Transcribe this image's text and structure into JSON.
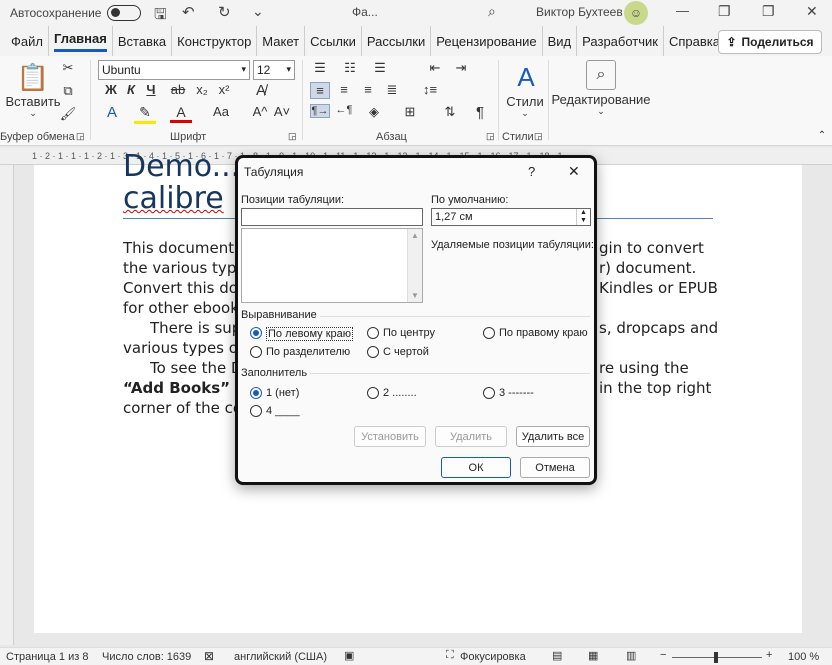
{
  "titlebar": {
    "autosave_label": "Автосохранение",
    "doc_name": "Фа...",
    "title_dots": "•",
    "user_name": "Виктор Бухтеев"
  },
  "menu": {
    "tabs": [
      "Файл",
      "Главная",
      "Вставка",
      "Конструктор",
      "Макет",
      "Ссылки",
      "Рассылки",
      "Рецензирование",
      "Вид",
      "Разработчик",
      "Справка"
    ],
    "share_label": "Поделиться"
  },
  "ribbon": {
    "paste_label": "Вставить",
    "clipboard_label": "Буфер обмена",
    "font_name": "Ubuntu",
    "font_size": "12",
    "font_group_label": "Шрифт",
    "para_group_label": "Абзац",
    "styles_label": "Стили",
    "styles_group_label": "Стили",
    "editing_label": "Редактирование",
    "bold": "Ж",
    "italic": "К",
    "underline": "Ч",
    "strike": "ab",
    "sub": "x₂",
    "sup": "x²",
    "case": "Aa",
    "grow": "A^",
    "shrink": "A˅"
  },
  "ruler_text": "1 · 2 · 1 · 1 · 1 · 2 · 1 · 3 · 1 · 4 · 1 · 5 · 1 · 6 · 1 · 7 · 1 · 8 · 1 · 9 · 1 · 10 · 1 · 11 · 1 · 12 · 1 · 13 · 1 · 14 · 1 · 15 · 1 · 16 · 17 · 1 · 18 · 1",
  "document": {
    "title_line1": "Demo...",
    "title_line2": "calibre",
    "para1_l1": "This document c",
    "para1_l1b": "gin to convert",
    "para1_l2": "the various typo",
    "para1_l2b": "r) document.",
    "para1_l3": "Convert this doc",
    "para1_l3b": "Kindles or EPUB",
    "para1_l4": "for other ebook",
    "para2_l1": "There is sup",
    "para2_l1b": "s, dropcaps and",
    "para2_l2": "various types of",
    "para3_l1": "To see the D",
    "para3_l1b": "re using the",
    "para3_l2": "“Add Books” bu",
    "para3_l2b": "in the top right",
    "para3_l3": "corner of the co"
  },
  "dialog": {
    "title": "Табуляция",
    "help": "?",
    "close": "✕",
    "tab_positions_label": "Позиции табуляции:",
    "tab_position_value": "",
    "default_label": "По умолчанию:",
    "default_value": "1,27 см",
    "cleared_label": "Удаляемые позиции табуляции:",
    "alignment_label": "Выравнивание",
    "align_left": "По левому краю",
    "align_center": "По центру",
    "align_right": "По правому краю",
    "align_decimal": "По разделителю",
    "align_bar": "С чертой",
    "leader_label": "Заполнитель",
    "leader1": "1 (нет)",
    "leader2": "2 ........",
    "leader3": "3 -------",
    "leader4": "4 ____",
    "set_button": "Установить",
    "clear_button": "Удалить",
    "clear_all_button": "Удалить все",
    "ok_button": "ОК",
    "cancel_button": "Отмена"
  },
  "status": {
    "page": "Страница 1 из 8",
    "words": "Число слов: 1639",
    "language": "английский (США)",
    "focus": "Фокусировка",
    "zoom": "100 %"
  },
  "colors": {
    "accent": "#185abd",
    "heading": "#17365d"
  }
}
